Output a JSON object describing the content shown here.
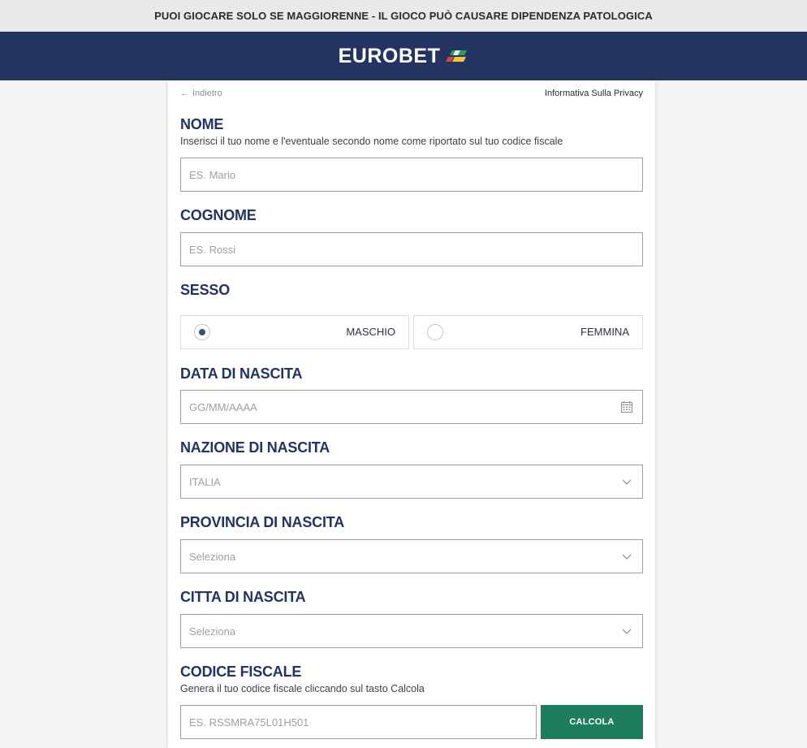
{
  "warning": {
    "text": "PUOI GIOCARE SOLO SE MAGGIORENNE - IL GIOCO PUÒ CAUSARE DIPENDENZA PATOLOGICA"
  },
  "header": {
    "brand": "EUROBET",
    "logo_icon": "eurobet-flag-icon",
    "colors": {
      "background": "#233462",
      "flag_red": "#d9473b",
      "flag_yellow": "#f2c43a",
      "flag_green": "#2f9e5c"
    }
  },
  "nav": {
    "back_label": "Indietro",
    "back_icon": "arrow-left-icon",
    "privacy_label": "Informativa Sulla Privacy"
  },
  "form": {
    "nome": {
      "label": "NOME",
      "hint": "Inserisci il tuo nome e l'eventuale secondo nome come riportato sul tuo codice fiscale",
      "placeholder": "ES. Mario",
      "value": ""
    },
    "cognome": {
      "label": "COGNOME",
      "placeholder": "ES. Rossi",
      "value": ""
    },
    "sesso": {
      "label": "SESSO",
      "options": [
        {
          "label": "MASCHIO",
          "checked": true
        },
        {
          "label": "FEMMINA",
          "checked": false
        }
      ]
    },
    "data_nascita": {
      "label": "DATA DI NASCITA",
      "placeholder": "GG/MM/AAAA",
      "icon": "calendar-icon"
    },
    "nazione_nascita": {
      "label": "NAZIONE DI NASCITA",
      "selected": "ITALIA",
      "icon": "chevron-down-icon"
    },
    "provincia_nascita": {
      "label": "PROVINCIA DI NASCITA",
      "selected": "Seleziona",
      "icon": "chevron-down-icon"
    },
    "citta_nascita": {
      "label": "CITTA DI NASCITA",
      "selected": "Seleziona",
      "icon": "chevron-down-icon"
    },
    "codice_fiscale": {
      "label": "CODICE FISCALE",
      "hint": "Genera il tuo codice fiscale cliccando sul tasto Calcola",
      "placeholder": "ES. RSSMRA75L01H501",
      "button_label": "CALCOLA",
      "button_color": "#1e7d5e"
    }
  }
}
